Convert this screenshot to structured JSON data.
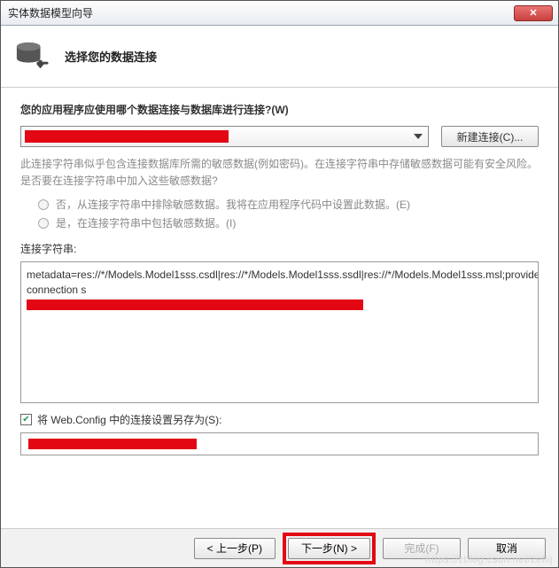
{
  "window": {
    "title": "实体数据模型向导",
    "close_glyph": "✕"
  },
  "header": {
    "subtitle": "选择您的数据连接"
  },
  "question": "您的应用程序应使用哪个数据连接与数据库进行连接?(W)",
  "new_connection_btn": "新建连接(C)...",
  "hint": "此连接字符串似乎包含连接数据库所需的敏感数据(例如密码)。在连接字符串中存储敏感数据可能有安全风险。是否要在连接字符串中加入这些敏感数据?",
  "radio_no": "否，从连接字符串中排除敏感数据。我将在应用程序代码中设置此数据。(E)",
  "radio_yes": "是，在连接字符串中包括敏感数据。(I)",
  "cs_label": "连接字符串:",
  "connection_string": "metadata=res://*/Models.Model1sss.csdl|res://*/Models.Model1sss.ssdl|res://*/Models.Model1sss.msl;provider=MySql.Data.MySqlClient;provider connection s",
  "save_checkbox_label": "将 Web.Config 中的连接设置另存为(S):",
  "save_checked": true,
  "footer": {
    "prev": "< 上一步(P)",
    "next": "下一步(N) >",
    "finish": "完成(F)",
    "cancel": "取消"
  },
  "watermark": "https://zblog.csdn.net/zeflij"
}
